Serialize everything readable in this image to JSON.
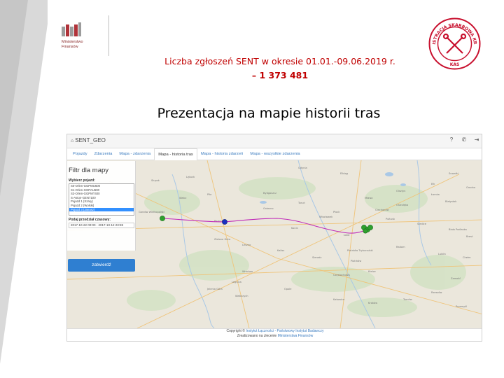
{
  "ministry": {
    "name_line1": "Ministerstwo",
    "name_line2": "Finansów"
  },
  "seal": {
    "arc_text": "ADMINISTRACJA SKARBOWA KRAJOWA",
    "abbrev": "KAS"
  },
  "header": {
    "line1": "Liczba zgłoszeń SENT w okresie 01.01.-09.06.2019 r.",
    "line2": "– 1 373 481"
  },
  "slide_title": "Prezentacja na mapie historii tras",
  "app": {
    "title": "SENT_GEO",
    "top_icons": [
      "help-icon",
      "phone-icon",
      "logout-icon"
    ],
    "tabs": [
      {
        "label": "Pojazdy",
        "active": false
      },
      {
        "label": "Zdarzenia",
        "active": false
      },
      {
        "label": "Mapa - zdarzenia",
        "active": false
      },
      {
        "label": "Mapa - historia tras",
        "active": true
      },
      {
        "label": "Mapa - historia zdarzeń",
        "active": false
      },
      {
        "label": "Mapa - wszystkie zdarzenia",
        "active": false
      }
    ],
    "filter": {
      "title": "Filtr dla mapy",
      "vehicle_label": "Wybierz pojazd:",
      "vehicles": [
        "S0-Orlen-GGPMU600",
        "S1-Orlen-GGPAU600",
        "S3-Orlen-GGPMT400",
        "S-Aston-GEN7100",
        "Pojazd 1 (Szary)",
        "Pojazd 2 (Wolski)",
        "Pojazd 3 (Janusz)"
      ],
      "selected_vehicle": "Pojazd 3 (Janusz)",
      "time_label": "Podaj przedział czasowy:",
      "time_range": "2017-10-22 00:00 - 2017-10-12 23:59",
      "confirm_label": "zatwierdź"
    },
    "map": {
      "places": [
        "Lębork",
        "Gdynia",
        "Słupsk",
        "Elbląg",
        "Olsztyn",
        "Piła",
        "Wałcz",
        "Bydgoszcz",
        "Toruń",
        "Gorzów Wielkopolski",
        "Poznań",
        "Zielona Góra",
        "Leszno",
        "Konin",
        "Łódź",
        "Kalisz",
        "Płock",
        "Sieradz",
        "Piotrków Trybunalski",
        "Radom",
        "Kielce",
        "Częstochowa",
        "Wrocław",
        "Opole",
        "Katowice",
        "Kraków",
        "Tarnów",
        "Rzeszów",
        "Przemyśl",
        "Lublin",
        "Chełm",
        "Zamość",
        "Siedlce",
        "Białystok",
        "Łomża",
        "Ostrołęka",
        "Suwałki",
        "Ełk",
        "Biała Podlaska",
        "Brest",
        "Grodno",
        "Piotrków",
        "Legnica",
        "Wałbrzych",
        "Jelenia Góra",
        "Gniezno",
        "Włocławek",
        "Ciechanów",
        "Mława",
        "Pułtusk"
      ],
      "route_color": "#c02ab8",
      "marker_color_green": "#2ea02e",
      "marker_color_blue": "#1a2fbf"
    },
    "footer": {
      "copyright_prefix": "Copyright © ",
      "copyright_link": "Instytut Łączności - Państwowy Instytut Badawczy",
      "ordered_prefix": "Zrealizowano na zlecenie ",
      "ordered_link": "Ministerstwa Finansów"
    }
  }
}
